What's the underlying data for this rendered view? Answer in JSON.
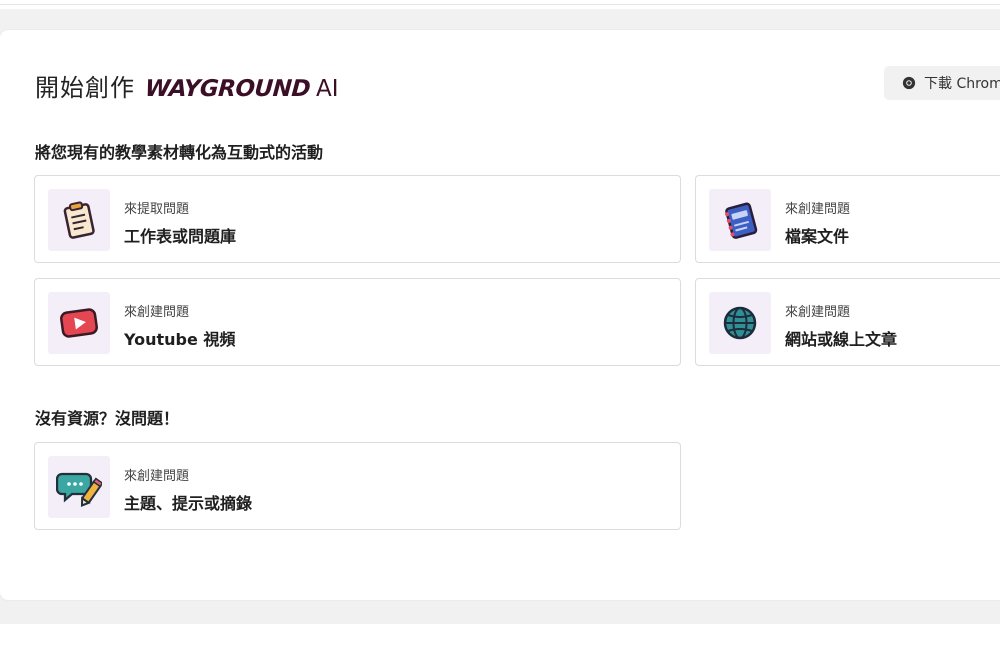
{
  "header": {
    "title": "開始創作",
    "brand": "WAYGROUND",
    "brand_suffix": "AI",
    "chrome_button": "下載 Chrome"
  },
  "sections": {
    "convert_title": "將您現有的教學素材轉化為互動式的活動",
    "no_resource_title": "沒有資源？沒問題！"
  },
  "cards": [
    {
      "subtitle": "來提取問題",
      "title": "工作表或問題庫",
      "icon": "clipboard-icon"
    },
    {
      "subtitle": "來創建問題",
      "title": "檔案文件",
      "icon": "notebook-icon"
    },
    {
      "subtitle": "來創建問題",
      "title": "Youtube 視頻",
      "icon": "youtube-play-icon"
    },
    {
      "subtitle": "來創建問題",
      "title": "網站或線上文章",
      "icon": "globe-icon"
    },
    {
      "subtitle": "來創建問題",
      "title": "主題、提示或摘錄",
      "icon": "chat-pencil-icon"
    }
  ],
  "colors": {
    "brand": "#3b1027",
    "tile_bg": "#f4eef9",
    "card_border": "#dcdcdc"
  }
}
